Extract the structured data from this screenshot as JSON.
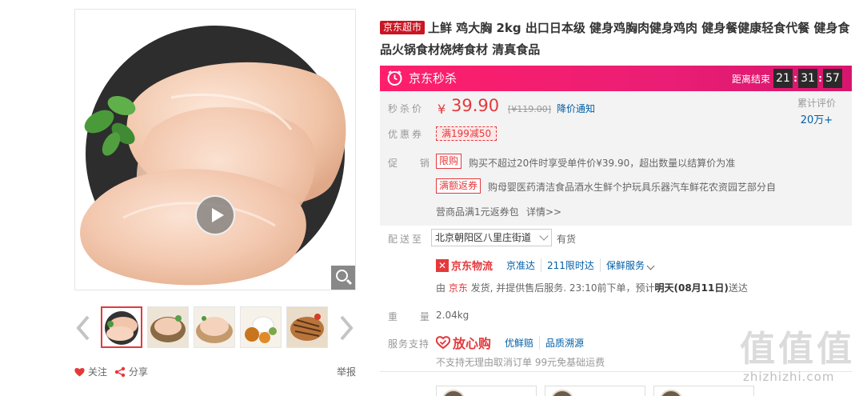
{
  "product": {
    "tag": "京东超市",
    "title": "上鲜 鸡大胸 2kg 出口日本级 健身鸡胸肉健身鸡肉 健身餐健康轻食代餐 健身食品火锅食材烧烤食材 清真食品"
  },
  "seckill": {
    "label": "京东秒杀",
    "countdown_label": "距离结束",
    "hours": "21",
    "minutes": "31",
    "seconds": "57"
  },
  "price": {
    "label": "秒杀价",
    "currency": "¥",
    "value": "39.90",
    "original": "[¥119.00]",
    "notice_link": "降价通知",
    "review_label": "累计评价",
    "review_count": "20万+"
  },
  "coupon": {
    "label": "优惠券",
    "tag": "满199减50"
  },
  "promotion": {
    "label": "促 销",
    "items": [
      {
        "tag": "限购",
        "text": "购买不超过20件时享受单件价¥39.90，超出数量以结算价为准"
      },
      {
        "tag": "满额返券",
        "text": "购母婴医药清洁食品酒水生鲜个护玩具乐器汽车鲜花农资园艺部分自"
      }
    ],
    "extra_text": "营商品满1元返券包",
    "detail_link": "详情>>"
  },
  "delivery": {
    "label": "配送至",
    "address": "北京朝阳区八里庄街道",
    "stock": "有货",
    "logistics_icon": "✕",
    "logistics_name": "京东物流",
    "links": [
      "京准达",
      "211限时达",
      "保鲜服务"
    ],
    "ship_prefix": "由 ",
    "ship_seller": "京东",
    "ship_middle": " 发货, 并提供售后服务. 23:10前下单，预计",
    "ship_date": "明天(08月11日)",
    "ship_suffix": "送达"
  },
  "weight": {
    "label": "重 量",
    "value": "2.04kg"
  },
  "service": {
    "label": "服务支持",
    "brand": "放心购",
    "links": [
      "优鲜赔",
      "品质溯源"
    ],
    "note": "不支持无理由取消订单  99元免基础运费"
  },
  "gallery_actions": {
    "follow": "关注",
    "share": "分享",
    "report": "举报"
  },
  "watermark": {
    "chars": "值值值",
    "url": "zhizhizhi.com"
  },
  "colors": {
    "accent_red": "#e4393c",
    "seckill_pink": "#ea1e74",
    "link_blue": "#005ea7"
  }
}
